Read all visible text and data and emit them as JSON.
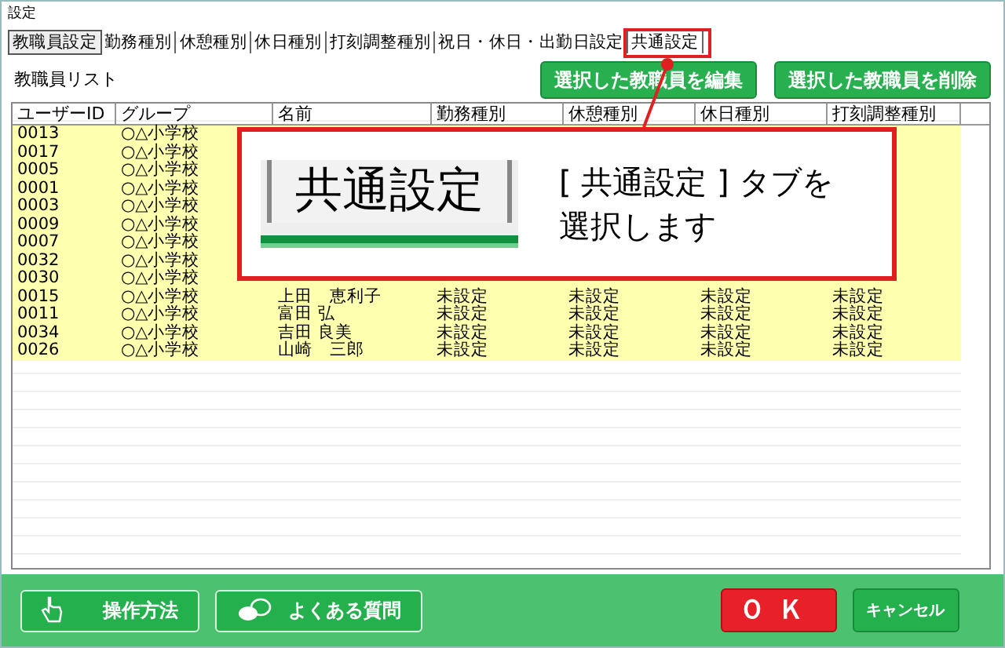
{
  "window": {
    "title": "設定"
  },
  "tabs": [
    {
      "label": "教職員設定",
      "selected": true
    },
    {
      "label": "勤務種別",
      "selected": false
    },
    {
      "label": "休憩種別",
      "selected": false
    },
    {
      "label": "休日種別",
      "selected": false
    },
    {
      "label": "打刻調整種別",
      "selected": false
    },
    {
      "label": "祝日・休日・出勤日設定",
      "selected": false
    },
    {
      "label": "共通設定",
      "selected": false
    }
  ],
  "list_title": "教職員リスト",
  "actions": [
    "選択した教職員を編集",
    "選択した教職員を削除"
  ],
  "table": {
    "columns": [
      "ユーザーID",
      "グループ",
      "名前",
      "勤務種別",
      "休憩種別",
      "休日種別",
      "打刻調整種別"
    ],
    "rows": [
      {
        "cells": [
          "0013",
          "○△小学校"
        ]
      },
      {
        "cells": [
          "0017",
          "○△小学校"
        ]
      },
      {
        "cells": [
          "0005",
          "○△小学校"
        ]
      },
      {
        "cells": [
          "0001",
          "○△小学校"
        ]
      },
      {
        "cells": [
          "0003",
          "○△小学校"
        ]
      },
      {
        "cells": [
          "0009",
          "○△小学校"
        ]
      },
      {
        "cells": [
          "0007",
          "○△小学校"
        ]
      },
      {
        "cells": [
          "0032",
          "○△小学校"
        ]
      },
      {
        "cells": [
          "0030",
          "○△小学校"
        ]
      },
      {
        "cells": [
          "0015",
          "○△小学校",
          "上田　恵利子",
          "未設定",
          "未設定",
          "未設定",
          "未設定"
        ]
      },
      {
        "cells": [
          "0011",
          "○△小学校",
          "富田 弘",
          "未設定",
          "未設定",
          "未設定",
          "未設定"
        ]
      },
      {
        "cells": [
          "0034",
          "○△小学校",
          "吉田 良美",
          "未設定",
          "未設定",
          "未設定",
          "未設定"
        ]
      },
      {
        "cells": [
          "0026",
          "○△小学校",
          "山崎　三郎",
          "未設定",
          "未設定",
          "未設定",
          "未設定"
        ]
      }
    ]
  },
  "callout": {
    "tab_label": "共通設定",
    "lines": [
      "[ 共通設定 ] タブを",
      "選択します"
    ]
  },
  "footer": {
    "help_buttons": [
      "操作方法",
      "よくある質問"
    ],
    "ok": "ＯＫ",
    "cancel": "キャンセル"
  }
}
